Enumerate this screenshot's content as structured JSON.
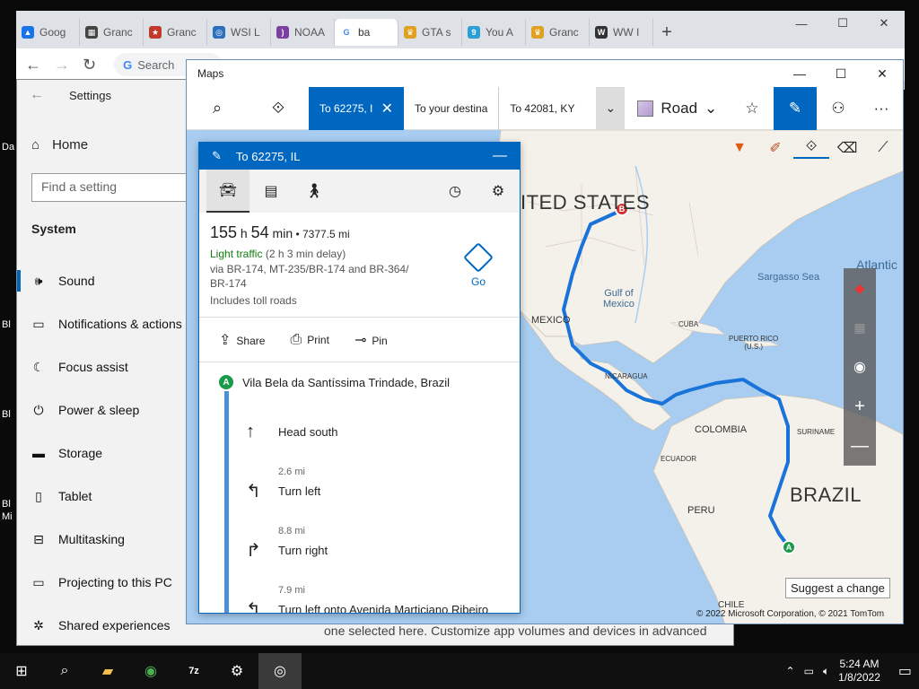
{
  "desktop": {
    "labels": [
      "Da",
      "Bl",
      "Bl",
      "Bl",
      "Mi"
    ]
  },
  "browser": {
    "tabs": [
      {
        "label": "Goog",
        "icon": "google-drive-icon",
        "color": "#1a73e8"
      },
      {
        "label": "Granc",
        "icon": "grid-icon",
        "color": "#444444"
      },
      {
        "label": "Granc",
        "icon": "rockstar-icon",
        "color": "#c0392b"
      },
      {
        "label": "WSI L",
        "icon": "wsi-icon",
        "color": "#2c6fbf"
      },
      {
        "label": "NOAA",
        "icon": "noaa-icon",
        "color": "#7b3fa0"
      },
      {
        "label": "ba",
        "icon": "google-icon",
        "color": "#4285f4"
      },
      {
        "label": "GTA s",
        "icon": "crown-icon",
        "color": "#e0a020"
      },
      {
        "label": "You A",
        "icon": "you-icon",
        "color": "#2a9fd6"
      },
      {
        "label": "Granc",
        "icon": "crown-icon",
        "color": "#e0a020"
      },
      {
        "label": "WW I",
        "icon": "ww-icon",
        "color": "#333333"
      }
    ],
    "new_tab": "+",
    "omnibox_placeholder": "Search"
  },
  "settings": {
    "title": "Settings",
    "home": "Home",
    "search_placeholder": "Find a setting",
    "section": "System",
    "items": [
      {
        "label": "Sound",
        "icon": "sound-icon"
      },
      {
        "label": "Notifications & actions",
        "icon": "notifications-icon"
      },
      {
        "label": "Focus assist",
        "icon": "moon-icon"
      },
      {
        "label": "Power & sleep",
        "icon": "power-icon"
      },
      {
        "label": "Storage",
        "icon": "storage-icon"
      },
      {
        "label": "Tablet",
        "icon": "tablet-icon"
      },
      {
        "label": "Multitasking",
        "icon": "multitasking-icon"
      },
      {
        "label": "Projecting to this PC",
        "icon": "projecting-icon"
      },
      {
        "label": "Shared experiences",
        "icon": "shared-icon"
      }
    ],
    "footer_text": "one selected here. Customize app volumes and devices in advanced"
  },
  "maps": {
    "title": "Maps",
    "toolbar": {
      "active_tab": "To 62275, I",
      "tab2": "To your destina",
      "tab3": "To 42081, KY",
      "view": "Road"
    },
    "map_labels": {
      "country_us": "ITED STATES",
      "gulf": "Gulf of\nMexico",
      "sargasso": "Sargasso Sea",
      "atlantic": "Atlantic",
      "mexico": "MEXICO",
      "cuba": "CUBA",
      "puerto_rico": "PUERTO RICO\n(U.S.)",
      "nicaragua": "NICARAGUA",
      "colombia": "COLOMBIA",
      "suriname": "SURINAME",
      "ecuador": "ECUADOR",
      "peru": "PERU",
      "brazil": "BRAZIL",
      "chile": "CHILE"
    },
    "suggest_change": "Suggest a change",
    "copyright": "© 2022 Microsoft Corporation, © 2021 TomTom"
  },
  "directions": {
    "header": "To 62275, IL",
    "hours": "155",
    "minutes": "54",
    "distance": "7377.5 mi",
    "traffic": "Light traffic",
    "delay": "(2 h 3 min delay)",
    "via": "via BR-174, MT-235/BR-174 and BR-364/ BR-174",
    "toll": "Includes toll roads",
    "go": "Go",
    "actions": {
      "share": "Share",
      "print": "Print",
      "pin": "Pin"
    },
    "start": "Vila Bela da Santíssima Trindade, Brazil",
    "steps": [
      {
        "distance": "",
        "text": "Head south",
        "arrow": "↑"
      },
      {
        "distance": "2.6 mi",
        "text": "Turn left",
        "arrow": "↰"
      },
      {
        "distance": "8.8 mi",
        "text": "Turn right",
        "arrow": "↱"
      },
      {
        "distance": "7.9 mi",
        "text": "Turn left onto Avenida Marticiano Ribeiro",
        "arrow": "↰"
      }
    ]
  },
  "taskbar": {
    "time": "5:24 AM",
    "date": "1/8/2022"
  }
}
